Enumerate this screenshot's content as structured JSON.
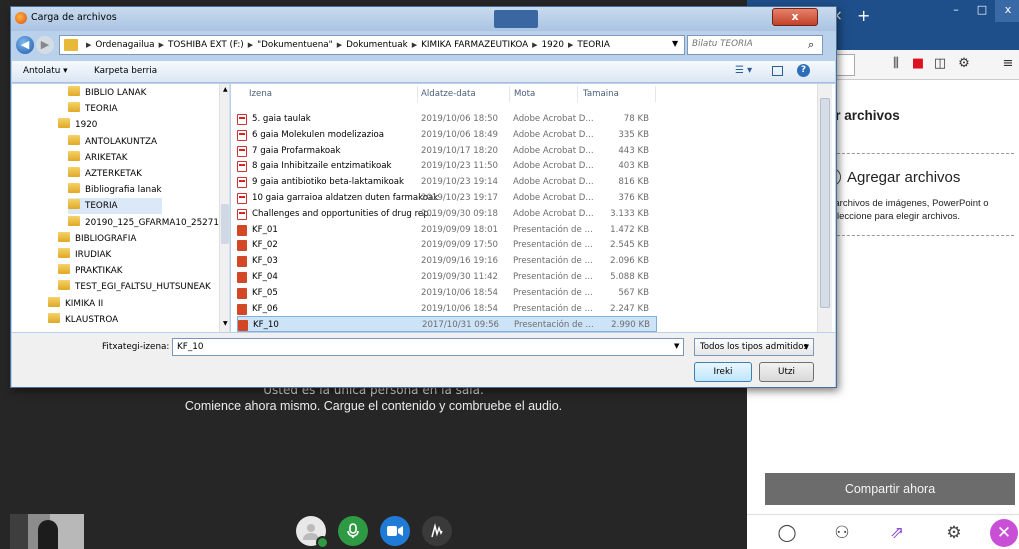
{
  "conference": {
    "message_single": "Usted es la única persona en la sala.",
    "message_start": "Comience ahora mismo. Cargue el contenido y combruebe el audio.",
    "share_panel_title": "tir archivos",
    "dropzone_title": "Agregar archivos",
    "dropzone_hint_1": "s archivos de imágenes, PowerPoint o",
    "dropzone_hint_2": "seleccione para elegir archivos.",
    "share_now_button": "Compartir ahora"
  },
  "browser": {
    "tab_close": "×",
    "new_tab": "+",
    "window_minimize": "–",
    "window_maximize": "□",
    "window_close": "x"
  },
  "dialog": {
    "title": "Carga de archivos",
    "close_label": "x",
    "breadcrumb": [
      "Ordenagailua",
      "TOSHIBA EXT (F:)",
      "\"Dokumentuena\"",
      "Dokumentuak",
      "KIMIKA FARMAZEUTIKOA",
      "1920",
      "TEORIA"
    ],
    "search_placeholder": "Bilatu TEORIA",
    "toolbar": {
      "organize": "Antolatu ▾",
      "new_folder": "Karpeta berria"
    },
    "tree": [
      {
        "label": "BIBLIO LANAK",
        "indent": 2
      },
      {
        "label": "TEORIA",
        "indent": 2
      },
      {
        "label": "1920",
        "indent": 1
      },
      {
        "label": "ANTOLAKUNTZA",
        "indent": 2
      },
      {
        "label": "ARIKETAK",
        "indent": 2
      },
      {
        "label": "AZTERKETAK",
        "indent": 2
      },
      {
        "label": "Bibliografia lanak",
        "indent": 2
      },
      {
        "label": "TEORIA",
        "indent": 2,
        "selected": true
      },
      {
        "label": "20190_125_GFARMA10_25271_",
        "indent": 2
      },
      {
        "label": "BIBLIOGRAFIA",
        "indent": 1
      },
      {
        "label": "IRUDIAK",
        "indent": 1
      },
      {
        "label": "PRAKTIKAK",
        "indent": 1
      },
      {
        "label": "TEST_EGI_FALTSU_HUTSUNEAK",
        "indent": 1
      },
      {
        "label": "KIMIKA II",
        "indent": 0
      },
      {
        "label": "KLAUSTROA",
        "indent": 0
      }
    ],
    "columns": {
      "name": "Izena",
      "date": "Aldatze-data",
      "type": "Mota",
      "size": "Tamaina"
    },
    "files": [
      {
        "name": "5. gaia taulak",
        "date": "2019/10/06 18:50",
        "type": "Adobe Acrobat D...",
        "size": "78 KB",
        "kind": "pdf"
      },
      {
        "name": "6 gaia Molekulen modelizazioa",
        "date": "2019/10/06 18:49",
        "type": "Adobe Acrobat D...",
        "size": "335 KB",
        "kind": "pdf"
      },
      {
        "name": "7 gaia Profarmakoak",
        "date": "2019/10/17 18:20",
        "type": "Adobe Acrobat D...",
        "size": "443 KB",
        "kind": "pdf"
      },
      {
        "name": "8 gaia Inhibitzaile entzimatikoak",
        "date": "2019/10/23 11:50",
        "type": "Adobe Acrobat D...",
        "size": "403 KB",
        "kind": "pdf"
      },
      {
        "name": "9 gaia antibiotiko beta-laktamikoak",
        "date": "2019/10/23 19:14",
        "type": "Adobe Acrobat D...",
        "size": "816 KB",
        "kind": "pdf"
      },
      {
        "name": "10 gaia garraioa aldatzen duten farmakoak",
        "date": "2019/10/23 19:17",
        "type": "Adobe Acrobat D...",
        "size": "376 KB",
        "kind": "pdf"
      },
      {
        "name": "Challenges and opportunities of drug rep...",
        "date": "2019/09/30 09:18",
        "type": "Adobe Acrobat D...",
        "size": "3.133 KB",
        "kind": "pdf"
      },
      {
        "name": "KF_01",
        "date": "2019/09/09 18:01",
        "type": "Presentación de ...",
        "size": "1.472 KB",
        "kind": "ppt"
      },
      {
        "name": "KF_02",
        "date": "2019/09/09 17:50",
        "type": "Presentación de ...",
        "size": "2.545 KB",
        "kind": "ppt"
      },
      {
        "name": "KF_03",
        "date": "2019/09/16 19:16",
        "type": "Presentación de ...",
        "size": "2.096 KB",
        "kind": "ppt"
      },
      {
        "name": "KF_04",
        "date": "2019/09/30 11:42",
        "type": "Presentación de ...",
        "size": "5.088 KB",
        "kind": "ppt"
      },
      {
        "name": "KF_05",
        "date": "2019/10/06 18:54",
        "type": "Presentación de ...",
        "size": "567 KB",
        "kind": "ppt"
      },
      {
        "name": "KF_06",
        "date": "2019/10/06 18:54",
        "type": "Presentación de ...",
        "size": "2.247 KB",
        "kind": "ppt"
      },
      {
        "name": "KF_10",
        "date": "2017/10/31 09:56",
        "type": "Presentación de ...",
        "size": "2.990 KB",
        "kind": "ppt",
        "selected": true
      }
    ],
    "filename_label": "Fitxategi-izena:",
    "filename_value": "KF_10",
    "filetype_value": "Todos los tipos admitidos",
    "open_button": "Ireki",
    "cancel_button": "Utzi"
  }
}
